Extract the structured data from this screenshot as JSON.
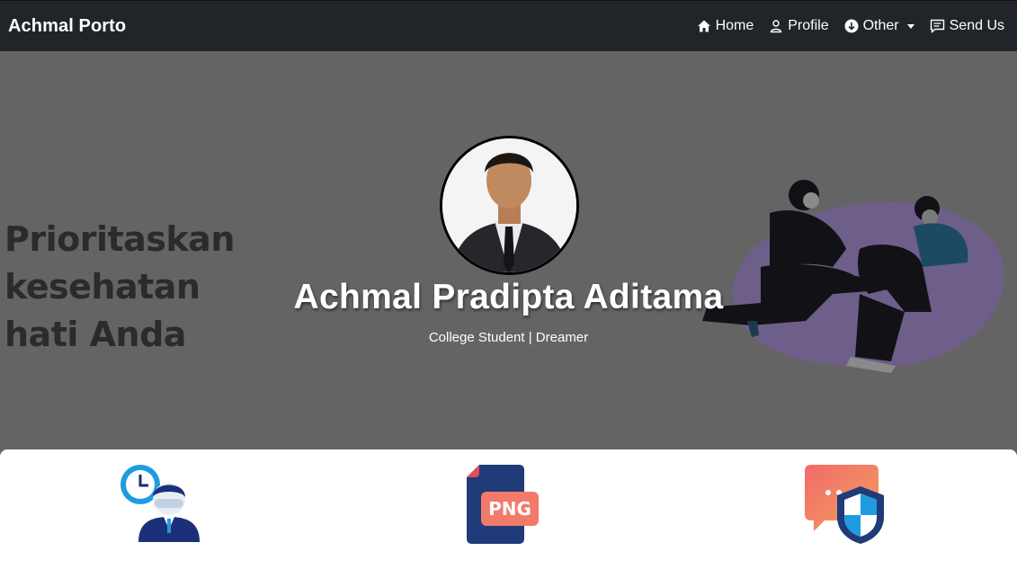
{
  "navbar": {
    "brand": "Achmal Porto",
    "items": [
      {
        "label": "Home",
        "icon": "house-icon"
      },
      {
        "label": "Profile",
        "icon": "person-icon"
      },
      {
        "label": "Other",
        "icon": "arrow-down-circle-icon",
        "dropdown": true
      },
      {
        "label": "Send Us",
        "icon": "chat-icon"
      }
    ]
  },
  "hero": {
    "background_text": [
      "Prioritaskan",
      "kesehatan",
      "hati Anda"
    ],
    "name": "Achmal Pradipta Aditama",
    "tagline": "College Student | Dreamer"
  },
  "features": [
    {
      "icon": "time-management-person-icon"
    },
    {
      "icon": "png-file-icon"
    },
    {
      "icon": "chat-shield-security-icon"
    }
  ],
  "colors": {
    "navbar_bg": "#212529",
    "hero_overlay": "#646464",
    "illustration_blob": "#6d5e8a"
  }
}
